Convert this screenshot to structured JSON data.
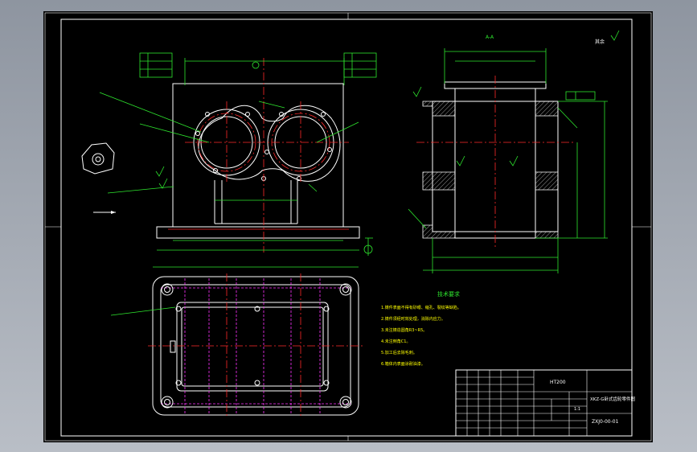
{
  "title_block": {
    "material": "HT200",
    "part_name": "XKZ-G卧式齿轮零件图",
    "drawing_number": "ZXJ0-00-01",
    "scale": "1:1"
  },
  "technical_requirements": {
    "heading": "技术要求",
    "items": [
      "1.铸件表面不得有砂眼、缩孔、裂纹等缺陷。",
      "2.铸件须经时效处理，消除内应力。",
      "3.未注铸造圆角R3~R5。",
      "4.未注倒角C1。",
      "5.加工后去除毛刺。",
      "6.箱体内表面涂耐油漆。"
    ]
  },
  "labels": {
    "section_label": "A-A",
    "roughness_note": "其余"
  },
  "colors": {
    "background": "#000000",
    "outline": "#ffffff",
    "center_line": "#ff2a2a",
    "dimension": "#2ee62e",
    "hidden_line": "#ff33ff",
    "annotation": "#ffff00"
  }
}
